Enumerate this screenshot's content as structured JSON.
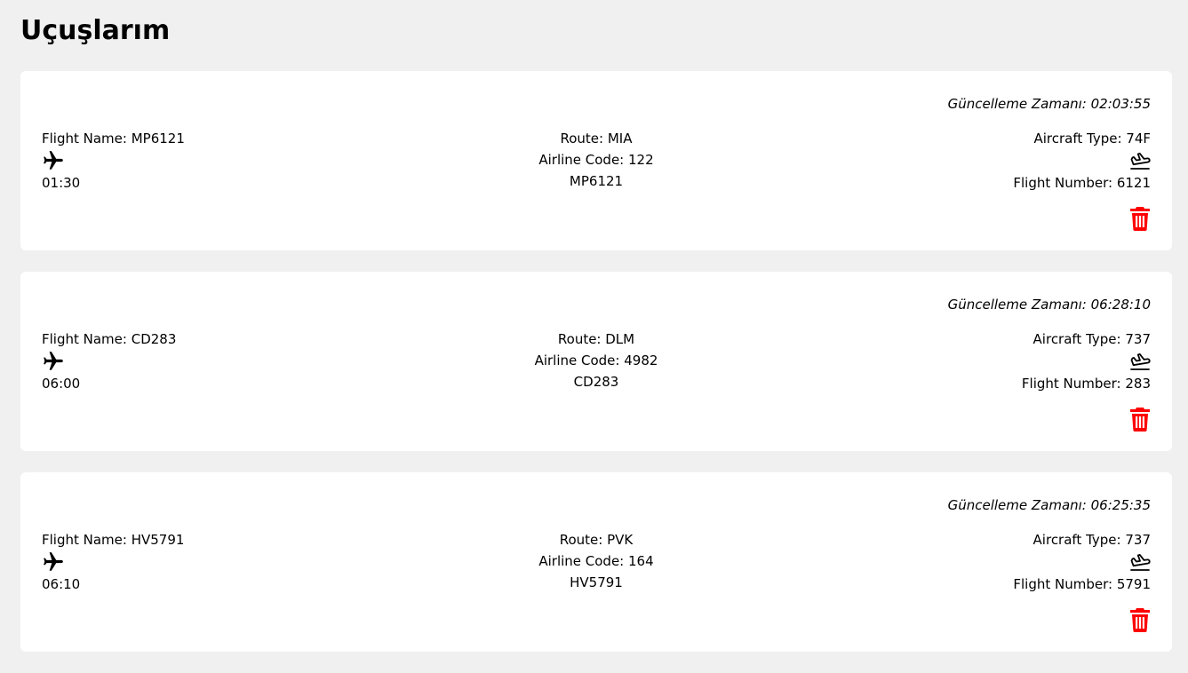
{
  "page": {
    "title": "Uçuşlarım"
  },
  "colors": {
    "background": "#f0f0f0",
    "card": "#ffffff",
    "text": "#000000",
    "delete": "#ff0000"
  },
  "icons": {
    "departure": "airplane-icon",
    "arrival": "plane-landing-icon",
    "delete": "trash-icon"
  },
  "flights": [
    {
      "updated": "Güncelleme Zamanı: 02:03:55",
      "flight_name": "Flight Name: MP6121",
      "time": "01:30",
      "route": "Route: MIA",
      "airline_code": "Airline Code: 122",
      "code": "MP6121",
      "aircraft_type": "Aircraft Type: 74F",
      "flight_number": "Flight Number: 6121"
    },
    {
      "updated": "Güncelleme Zamanı: 06:28:10",
      "flight_name": "Flight Name: CD283",
      "time": "06:00",
      "route": "Route: DLM",
      "airline_code": "Airline Code: 4982",
      "code": "CD283",
      "aircraft_type": "Aircraft Type: 737",
      "flight_number": "Flight Number: 283"
    },
    {
      "updated": "Güncelleme Zamanı: 06:25:35",
      "flight_name": "Flight Name: HV5791",
      "time": "06:10",
      "route": "Route: PVK",
      "airline_code": "Airline Code: 164",
      "code": "HV5791",
      "aircraft_type": "Aircraft Type: 737",
      "flight_number": "Flight Number: 5791"
    }
  ]
}
